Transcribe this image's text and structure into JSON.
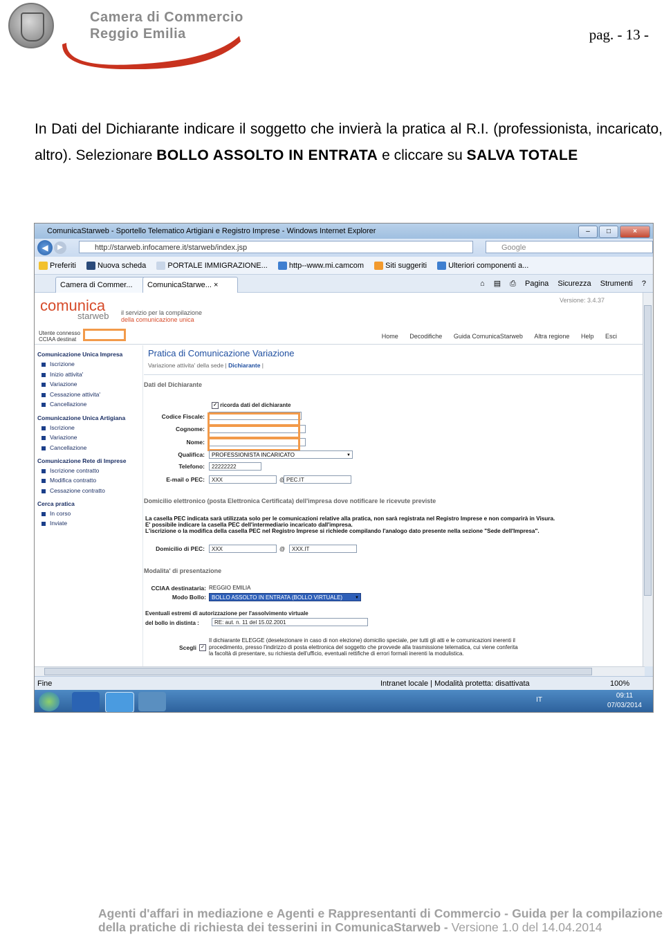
{
  "header": {
    "org_line1": "Camera di Commercio",
    "org_line2": "Reggio Emilia",
    "page_number": "pag. - 13 -"
  },
  "intro": {
    "part1": "In Dati  del Dichiarante indicare il soggetto che invierà la pratica al R.I. (professionista, incaricato, altro). Selezionare ",
    "bold1": "BOLLO ASSOLTO IN ENTRATA",
    "part2": " e cliccare su ",
    "bold2": "SALVA TOTALE"
  },
  "browser": {
    "title": "ComunicaStarweb - Sportello Telematico Artigiani e Registro Imprese - Windows Internet Explorer",
    "url": "http://starweb.infocamere.it/starweb/index.jsp",
    "search_placeholder": "Google",
    "favorites": [
      "Preferiti",
      "Nuova scheda",
      "PORTALE IMMIGRAZIONE...",
      "http--www.mi.camcom",
      "Siti suggeriti",
      "Ulteriori componenti a..."
    ],
    "tabs": [
      "Camera di Commer...",
      "ComunicaStarwe..."
    ],
    "commands": [
      "Pagina",
      "Sicurezza",
      "Strumenti"
    ],
    "status_left": "Fine",
    "status_zone": "Intranet locale | Modalità protetta: disattivata",
    "zoom": "100%",
    "lang": "IT",
    "time": "09:11",
    "date": "07/03/2014"
  },
  "app": {
    "logo_main": "comunica",
    "logo_sub": "starweb",
    "tagline1": "il servizio per la compilazione",
    "tagline2_a": "della comunicazione ",
    "tagline2_b": "unica",
    "version": "Versione: 3.4.37",
    "user_line1": "Utente connesso",
    "user_line2": "CCIAA destinat",
    "topnav": [
      "Home",
      "Decodifiche",
      "Guida ComunicaStarweb",
      "Altra regione",
      "Help",
      "Esci"
    ],
    "sidebar": {
      "group1": "Comunicazione Unica Impresa",
      "group1_items": [
        "Iscrizione",
        "Inizio attivita'",
        "Variazione",
        "Cessazione attivita'",
        "Cancellazione"
      ],
      "group2": "Comunicazione Unica Artigiana",
      "group2_items": [
        "Iscrizione",
        "Variazione",
        "Cancellazione"
      ],
      "group3": "Comunicazione Rete di Imprese",
      "group3_items": [
        "Iscrizione contratto",
        "Modifica contratto",
        "Cessazione contratto"
      ],
      "group4": "Cerca pratica",
      "group4_items": [
        "In corso",
        "Inviate"
      ]
    },
    "page_title": "Pratica di Comunicazione Variazione",
    "page_sub_a": "Variazione attivita' della sede  |  ",
    "page_sub_b": "Dichiarante",
    "page_sub_c": "  |",
    "sect_dichiarante": "Dati del Dichiarante",
    "ricorda": "ricorda dati del dichiarante",
    "labels": {
      "cf": "Codice Fiscale:",
      "cognome": "Cognome:",
      "nome": "Nome:",
      "qualifica": "Qualifica:",
      "telefono": "Telefono:",
      "email": "E-mail o PEC:"
    },
    "values": {
      "qualifica": "PROFESSIONISTA INCARICATO",
      "telefono": "22222222",
      "email_user": "XXX",
      "email_domain": "PEC.IT"
    },
    "sect_domicilio": "Domicilio elettronico (posta Elettronica Certificata) dell'impresa dove notificare le ricevute previste",
    "pec_note1": "La casella PEC indicata sarà utilizzata solo per le comunicazioni relative alla pratica, non sarà registrata nel Registro Imprese e non comparirà in Visura.",
    "pec_note2": "E' possibile indicare la casella PEC dell'intermediario incaricato dall'impresa.",
    "pec_note3": "L'iscrizione o la modifica della casella PEC nel Registro Imprese si richiede compilando l'analogo dato presente nella sezione \"Sede dell'Impresa\".",
    "domicilio_label": "Domicilio di PEC:",
    "domicilio_user": "XXX",
    "domicilio_domain": "XXX.IT",
    "sect_modalita": "Modalita' di presentazione",
    "cciaa_label": "CCIAA destinataria:",
    "cciaa_value": "REGGIO EMILIA",
    "bollo_label": "Modo Bollo:",
    "bollo_value": "BOLLO ASSOLTO IN ENTRATA (BOLLO VIRTUALE)",
    "estremi_line1": "Eventuali estremi di autorizzazione per l'assolvimento virtuale",
    "estremi_line2": "del bollo in distinta :",
    "estremi_value": "RE: aut. n. 11 del 15.02.2001",
    "scegli": "Scegli",
    "elegge1": "Il dichiarante ELEGGE (deselezionare in caso di non elezione) domicilio speciale, per tutti gli atti e le comunicazioni inerenti il",
    "elegge2": "procedimento, presso l'indirizzo di posta elettronica del soggetto che provvede alla trasmissione telematica, cui viene conferita",
    "elegge3": "la facoltà di presentare, su richiesta dell'ufficio, eventuali rettifiche di errori formali inerenti la modulistica."
  },
  "footer": {
    "line_a": "Agenti d'affari in mediazione e Agenti e  Rappresentanti di Commercio - Guida  per la compilazione della pratiche di richiesta dei tesserini in ComunicaStarweb - ",
    "line_b": " Versione 1.0 del 14.04.2014"
  },
  "colors": {
    "highlight": "#f29a4a",
    "link_blue": "#1f4fa0",
    "brand_red": "#c8321e"
  }
}
